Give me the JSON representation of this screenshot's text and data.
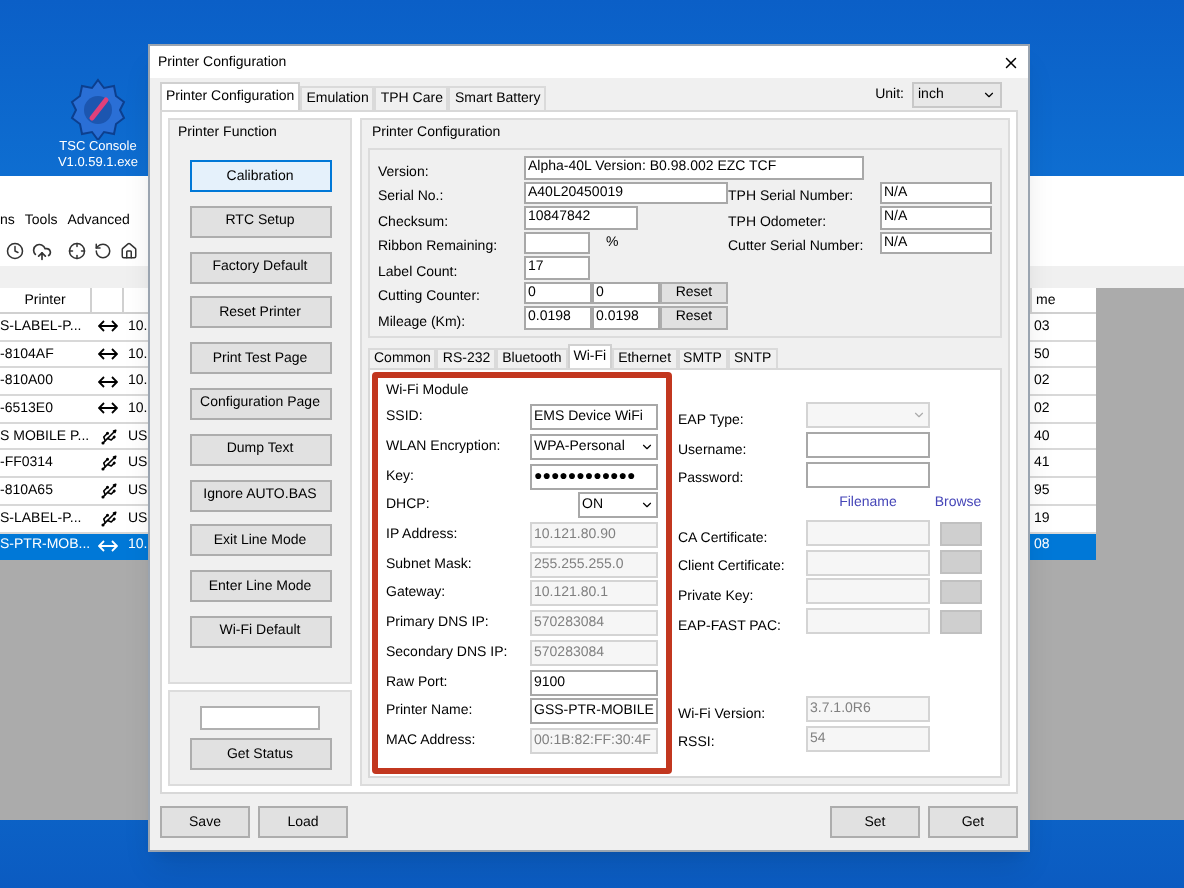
{
  "desktop": {
    "icon_label": [
      "TSC Console",
      "V1.0.59.1.exe"
    ]
  },
  "background_window": {
    "menu": [
      "ns",
      "Tools",
      "Advanced"
    ],
    "table": {
      "columns": [
        "Printer",
        "me"
      ],
      "rows": [
        {
          "printer": "S-LABEL-P...",
          "kind": "network",
          "address": "10.",
          "column_4": "03",
          "selected": false
        },
        {
          "printer": "-8104AF",
          "kind": "network",
          "address": "10.",
          "column_4": "50",
          "selected": false
        },
        {
          "printer": "-810A00",
          "kind": "network",
          "address": "10.",
          "column_4": "02",
          "selected": false
        },
        {
          "printer": "-6513E0",
          "kind": "network",
          "address": "10.",
          "column_4": "02",
          "selected": false
        },
        {
          "printer": "S MOBILE P...",
          "kind": "usb",
          "address": "US",
          "column_4": "40",
          "selected": false
        },
        {
          "printer": "-FF0314",
          "kind": "usb",
          "address": "US",
          "column_4": "41",
          "selected": false
        },
        {
          "printer": "-810A65",
          "kind": "usb",
          "address": "US",
          "column_4": "95",
          "selected": false
        },
        {
          "printer": "S-LABEL-P...",
          "kind": "usb",
          "address": "US",
          "column_4": "19",
          "selected": false
        },
        {
          "printer": "S-PTR-MOB...",
          "kind": "network",
          "address": "10.",
          "column_4": "08",
          "selected": true
        }
      ]
    }
  },
  "dialog": {
    "title": "Printer Configuration",
    "tabs": [
      {
        "label": "Printer Configuration",
        "selected": true
      },
      {
        "label": "Emulation",
        "selected": false
      },
      {
        "label": "TPH Care",
        "selected": false
      },
      {
        "label": "Smart Battery",
        "selected": false
      }
    ],
    "unit": {
      "label": "Unit:",
      "value": "inch"
    },
    "printer_function": {
      "title": "Printer Function",
      "buttons": [
        {
          "label": "Calibration",
          "focused": true
        },
        {
          "label": "RTC Setup",
          "focused": false
        },
        {
          "label": "Factory Default",
          "focused": false
        },
        {
          "label": "Reset Printer",
          "focused": false
        },
        {
          "label": "Print Test Page",
          "focused": false
        },
        {
          "label": "Configuration Page",
          "focused": false
        },
        {
          "label": "Dump Text",
          "focused": false
        },
        {
          "label": "Ignore AUTO.BAS",
          "focused": false
        },
        {
          "label": "Exit Line Mode",
          "focused": false
        },
        {
          "label": "Enter Line Mode",
          "focused": false
        },
        {
          "label": "Wi-Fi Default",
          "focused": false
        }
      ],
      "status_button": "Get Status"
    },
    "printer_configuration": {
      "title": "Printer Configuration",
      "version": {
        "label": "Version:",
        "value": "Alpha-40L Version: B0.98.002 EZC TCF"
      },
      "serial": {
        "label": "Serial No.:",
        "value": "A40L20450019"
      },
      "checksum": {
        "label": "Checksum:",
        "value": "10847842"
      },
      "ribbon": {
        "label": "Ribbon Remaining:",
        "unit": "%"
      },
      "label_count": {
        "label": "Label Count:",
        "value": "17"
      },
      "cutting_counter": {
        "label": "Cutting Counter:",
        "values": [
          "0",
          "0"
        ],
        "button": "Reset"
      },
      "mileage": {
        "label": "Mileage (Km):",
        "values": [
          "0.0198",
          "0.0198"
        ],
        "button": "Reset"
      },
      "tph": [
        {
          "label": "TPH Serial Number:",
          "value": "N/A"
        },
        {
          "label": "TPH Odometer:",
          "value": "N/A"
        },
        {
          "label": "Cutter Serial Number:",
          "value": "N/A"
        }
      ]
    },
    "sub_tabs": [
      {
        "label": "Common",
        "selected": false
      },
      {
        "label": "RS-232",
        "selected": false
      },
      {
        "label": "Bluetooth",
        "selected": false
      },
      {
        "label": "Wi-Fi",
        "selected": true
      },
      {
        "label": "Ethernet",
        "selected": false
      },
      {
        "label": "SMTP",
        "selected": false
      },
      {
        "label": "SNTP",
        "selected": false
      }
    ],
    "wifi": {
      "title": "Wi-Fi Module",
      "highlighted": true,
      "fields": [
        {
          "label": "SSID:",
          "kind": "text",
          "value": "EMS Device WiFi",
          "disabled": false
        },
        {
          "label": "WLAN Encryption:",
          "kind": "select",
          "value": "WPA-Personal",
          "disabled": false
        },
        {
          "label": "Key:",
          "kind": "text",
          "value": "●●●●●●●●●●●●",
          "disabled": false
        },
        {
          "label": "DHCP:",
          "kind": "short-select",
          "value": "ON",
          "disabled": false
        },
        {
          "label": "IP Address:",
          "kind": "text",
          "value": "10.121.80.90",
          "disabled": true
        },
        {
          "label": "Subnet Mask:",
          "kind": "text",
          "value": "255.255.255.0",
          "disabled": true
        },
        {
          "label": "Gateway:",
          "kind": "text",
          "value": "10.121.80.1",
          "disabled": true
        },
        {
          "label": "Primary DNS IP:",
          "kind": "text",
          "value": "570283084",
          "disabled": true
        },
        {
          "label": "Secondary DNS IP:",
          "kind": "text",
          "value": "570283084",
          "disabled": true
        },
        {
          "label": "Raw Port:",
          "kind": "text",
          "value": "9100",
          "disabled": false
        },
        {
          "label": "Printer Name:",
          "kind": "text",
          "value": "GSS-PTR-MOBILE",
          "disabled": false
        },
        {
          "label": "MAC Address:",
          "kind": "text",
          "value": "00:1B:82:FF:30:4F",
          "disabled": true
        }
      ],
      "eap": [
        {
          "label": "EAP Type:",
          "kind": "select",
          "disabled": true
        },
        {
          "label": "Username:",
          "kind": "text",
          "disabled": false
        },
        {
          "label": "Password:",
          "kind": "text",
          "disabled": false
        }
      ],
      "cert_headings": [
        "Filename",
        "Browse"
      ],
      "certificates": [
        "CA Certificate:",
        "Client Certificate:",
        "Private Key:",
        "EAP-FAST PAC:"
      ],
      "version_fields": [
        {
          "label": "Wi-Fi Version:",
          "value": "3.7.1.0R6"
        },
        {
          "label": "RSSI:",
          "value": "54"
        }
      ]
    },
    "footer_left": [
      "Save",
      "Load"
    ],
    "footer_right": [
      "Set",
      "Get"
    ]
  }
}
